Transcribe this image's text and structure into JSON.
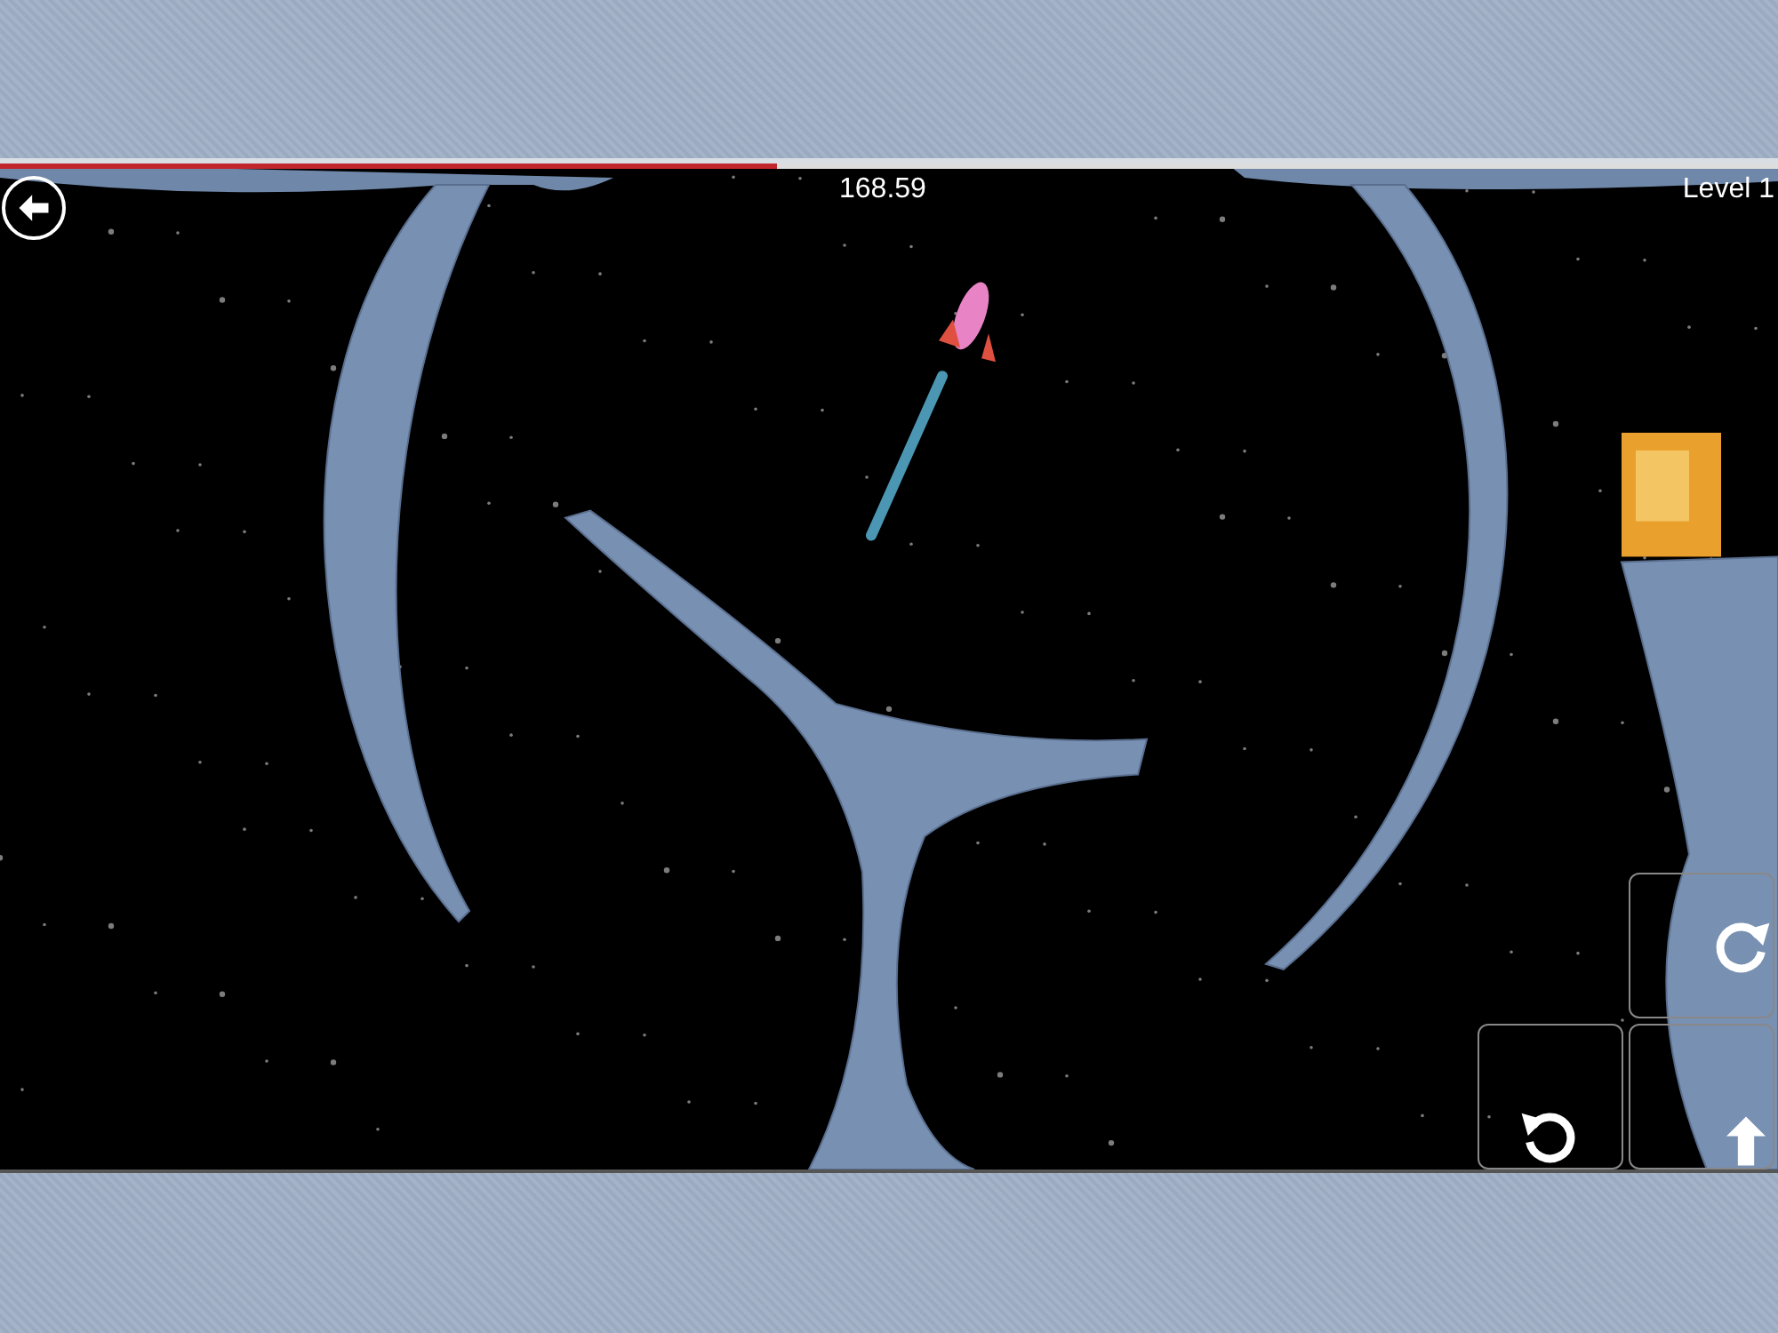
{
  "hud": {
    "progress": {
      "level": 0.437
    },
    "timer": "168.59",
    "level_label": "Level 1"
  },
  "controls": [
    {
      "kind": "rotate-right"
    },
    {
      "kind": "rotate-left"
    },
    {
      "kind": "thrust"
    }
  ]
}
